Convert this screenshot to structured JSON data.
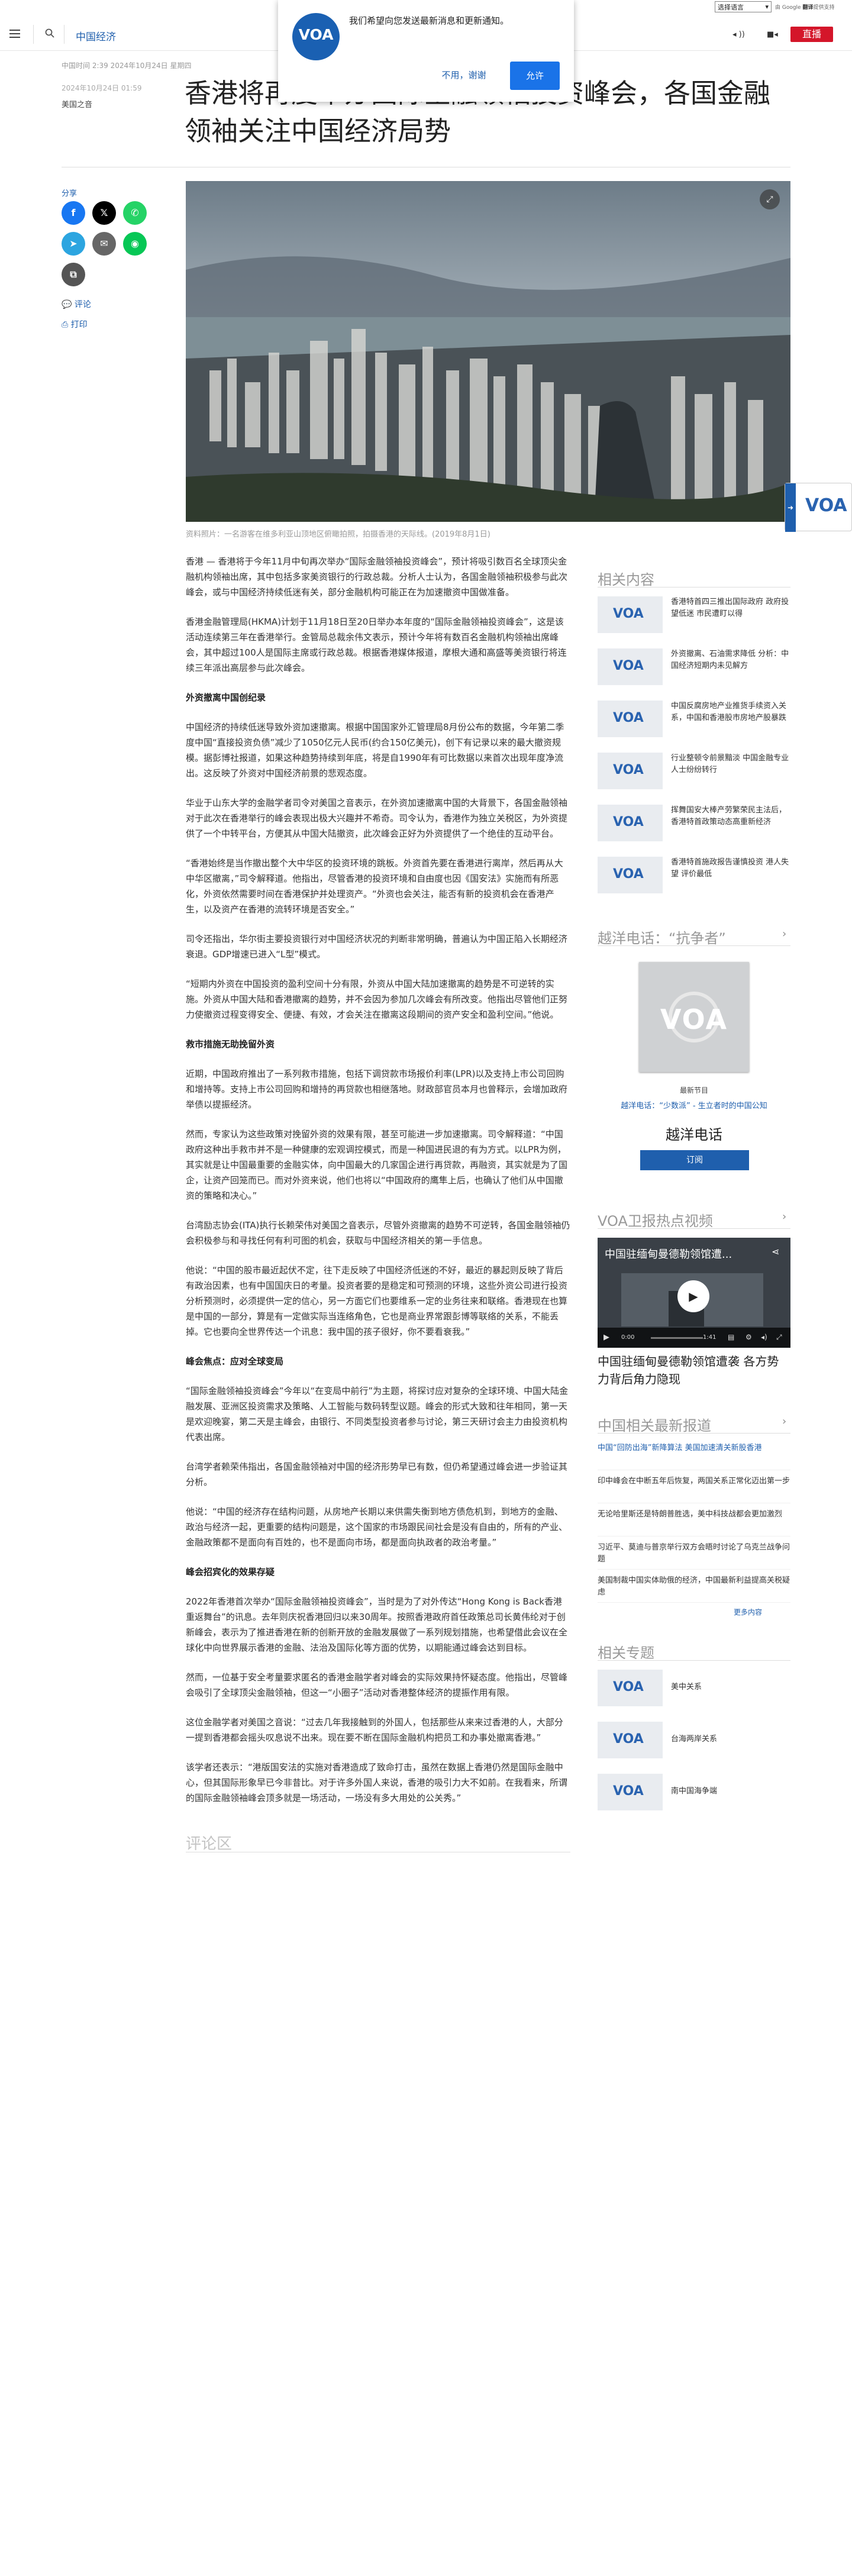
{
  "topbar": {
    "language_select": "选择语言",
    "translate_prefix": "由 Google",
    "translate_brand": "翻译",
    "translate_suffix": "提供支持"
  },
  "header": {
    "section": "中国经济",
    "live_label": "直播"
  },
  "popup": {
    "message": "我们希望向您发送最新消息和更新通知。",
    "decline": "不用，谢谢",
    "accept": "允许",
    "logo": "VOA"
  },
  "article": {
    "date": "中国时间 2:39 2024年10月24日 星期四",
    "date2": "2024年10月24日 01:59",
    "author": "美国之音",
    "headline": "香港将再度举办国际金融领袖投资峰会，各国金融领袖关注中国经济局势",
    "caption": "资料照片：一名游客在维多利亚山顶地区俯瞰拍照，拍摄香港的天际线。(2019年8月1日)",
    "share_label": "分享",
    "comments_link": "评论",
    "print_link": "打印",
    "paragraphs": [
      {
        "type": "p",
        "text": "香港 — 香港将于今年11月中旬再次举办“国际金融领袖投资峰会”，预计将吸引数百名全球顶尖金融机构领袖出席，其中包括多家美资银行的行政总裁。分析人士认为，各国金融领袖积极参与此次峰会，或与中国经济持续低迷有关，部分金融机构可能正在为加速撤资中国做准备。"
      },
      {
        "type": "p",
        "text": "香港金融管理局(HKMA)计划于11月18日至20日举办本年度的“国际金融领袖投资峰会”，这是该活动连续第三年在香港举行。金管局总裁余伟文表示，预计今年将有数百名金融机构领袖出席峰会，其中超过100人是国际主席或行政总裁。根据香港媒体报道，摩根大通和高盛等美资银行将连续三年派出高层参与此次峰会。"
      },
      {
        "type": "h",
        "text": "外资撤离中国创纪录"
      },
      {
        "type": "p",
        "text": "中国经济的持续低迷导致外资加速撤离。根据中国国家外汇管理局8月份公布的数据，今年第二季度中国“直接投资负债”减少了1050亿元人民币(约合150亿美元)，创下有记录以来的最大撤资规模。据彭博社报道，如果这种趋势持续到年底，将是自1990年有可比数据以来首次出现年度净流出。这反映了外资对中国经济前景的悲观态度。"
      },
      {
        "type": "p",
        "text": "华业于山东大学的金融学者司令对美国之音表示，在外资加速撤离中国的大背景下，各国金融领袖对于此次在香港举行的峰会表现出极大兴趣并不希奇。司令认为，香港作为独立关税区，为外资提供了一个中转平台，方便其从中国大陆撤资，此次峰会正好为外资提供了一个绝佳的互动平台。"
      },
      {
        "type": "p",
        "text": "“香港始终是当作撤出整个大中华区的投资环境的跳板。外资首先要在香港进行离岸，然后再从大中华区撤离，”司令解释道。他指出，尽管香港的投资环境和自由度也因《国安法》实施而有所恶化，外资依然需要时间在香港保护并处理资产。“外资也会关注，能否有新的投资机会在香港产生，以及资产在香港的流转环境是否安全。”"
      },
      {
        "type": "p",
        "text": "司令还指出，华尔街主要投资银行对中国经济状况的判断非常明确，普遍认为中国正陷入长期经济衰退。GDP增速已进入“L型”模式。"
      },
      {
        "type": "p",
        "text": "“短期内外资在中国投资的盈利空间十分有限，外资从中国大陆加速撤离的趋势是不可逆转的实施。外资从中国大陆和香港撤离的趋势，并不会因为参加几次峰会有所改变。他指出尽管他们正努力使撤资过程变得安全、便捷、有效，才会关注在撤离这段期间的资产安全和盈利空间。”他说。"
      },
      {
        "type": "h",
        "text": "救市措施无助挽留外资"
      },
      {
        "type": "p",
        "text": "近期，中国政府推出了一系列救市措施，包括下调贷款市场报价利率(LPR)以及支持上市公司回购和增持等。支持上市公司回购和增持的再贷款也相继落地。财政部官员本月也曾释示，会增加政府举债以提振经济。"
      },
      {
        "type": "p",
        "text": "然而，专家认为这些政策对挽留外资的效果有限，甚至可能进一步加速撤离。司令解释道：“中国政府这种出手救市并不是一种健康的宏观调控模式，而是一种国进民退的有为方式。以LPR为例，其实就是让中国最重要的金融实体，向中国最大的几家国企进行再贷款，再融资，其实就是为了国企，让资产回笼而已。而对外资来说，他们也将以“中国政府的鹰隼上后，也确认了他们从中国撤资的策略和决心。”"
      },
      {
        "type": "p",
        "text": "台湾励志协会(ITA)执行长赖荣伟对美国之音表示，尽管外资撤离的趋势不可逆转，各国金融领袖仍会积极参与和寻找任何有利可图的机会，获取与中国经济相关的第一手信息。"
      },
      {
        "type": "p",
        "text": "他说：“中国的股市最近起伏不定，往下走反映了中国经济低迷的不好，最近的暴起则反映了背后有政治因素，也有中国国庆日的考量。投资者要的是稳定和可预测的环境，这些外资公司进行投资分析预测时，必须提供一定的信心，另一方面它们也要维系一定的业务往来和联络。香港现在也算是中国的一部分，算是有一定做实际当连络角色，它也是商业界常跟彭博等联络的关系，不能丢掉。它也要向全世界传达一个讯息：我中国的孩子很好，你不要看衰我。”"
      },
      {
        "type": "h",
        "text": "峰会焦点：应对全球变局"
      },
      {
        "type": "p",
        "text": "“国际金融领袖投资峰会”今年以“在变局中前行”为主题，将探讨应对复杂的全球环境、中国大陆金融发展、亚洲区投资需求及策略、人工智能与数码转型议题。峰会的形式大致和往年相同，第一天是欢迎晚宴，第二天是主峰会，由银行、不同类型投资者参与讨论，第三天研讨会主力由投资机构代表出席。"
      },
      {
        "type": "p",
        "text": "台湾学者赖荣伟指出，各国金融领袖对中国的经济形势早已有数，但仍希望通过峰会进一步验证其分析。"
      },
      {
        "type": "p",
        "text": "他说：“中国的经济存在结构问题，从房地产长期以来供需失衡到地方债危机到，到地方的金融、政治与经济一起，更重要的结构问题是，这个国家的市场跟民间社会是没有自由的，所有的产业、金融政策都不是面向有百姓的，也不是面向市场，都是面向执政者的政治考量。”"
      },
      {
        "type": "h",
        "text": "峰会招宾化的效果存疑"
      },
      {
        "type": "p",
        "text": "2022年香港首次举办“国际金融领袖投资峰会”，当时是为了对外传达“Hong Kong is Back香港重返舞台”的讯息。去年则庆祝香港回归以来30周年。按照香港政府首任政策总司长黄伟纶对于创新峰会，表示为了推进香港在新的创新开放的金融发展做了一系列规划措施，也希望借此会议在全球化中向世界展示香港的金融、法治及国际化等方面的优势，以期能通过峰会达到目标。"
      },
      {
        "type": "p",
        "text": "然而，一位基于安全考量要求匿名的香港金融学者对峰会的实际效果持怀疑态度。他指出，尽管峰会吸引了全球顶尖金融领袖，但这一“小圈子”活动对香港整体经济的提振作用有限。"
      },
      {
        "type": "p",
        "text": "这位金融学者对美国之音说：“过去几年我接触到的外国人，包括那些从来来过香港的人，大部分一提到香港都会摇头叹息说不出来。现在要不断在国际金融机构把员工和办事处撤离香港。”"
      },
      {
        "type": "p",
        "text": "该学者还表示：“港版国安法的实施对香港造成了致命打击，虽然在数据上香港仍然是国际金融中心，但其国际形象早已今非昔比。对于许多外国人来说，香港的吸引力大不如前。在我看来，所谓的国际金融领袖峰会顶多就是一场活动，一场没有多大用处的公关秀。”"
      }
    ]
  },
  "comments": {
    "heading": "评论区"
  },
  "sidebar": {
    "related_heading": "相关内容",
    "related": [
      "香港特首四三推出国际政府 政府投望低迷 市民遭盯以得",
      "外资撤离、石油需求降低 分析：中国经济短期内未见解方",
      "中国反腐房地产业推货手续资入关系，中国和香港股市房地产股暴跌",
      "行业整顿令前景黯淡 中国金融专业人士纷纷转行",
      "挥舞国安大棒产劳繁荣民主法后，香港特首政策动态高重新经济",
      "香港特首施政报告谨慎投资 港人失望 评价最低"
    ],
    "podcast_heading": "越洋电话：“抗争者”",
    "podcast_small": "最新节目",
    "podcast_link": "越洋电话：“少数派” - 生立者时的中国公知",
    "podcast_title": "越洋电话",
    "podcast_btn": "订阅",
    "video_heading": "VOA卫报热点视频",
    "video_title": "中国驻缅甸曼德勒领馆遭...",
    "video_time": "0:00",
    "video_duration": "1:41",
    "video_caption": "中国驻缅甸曼德勒领馆遭袭 各方势力背后角力隐现",
    "news_heading": "中国相关最新报道",
    "news": [
      "中国“回防出海”新降算法 美国加速清关新股香港",
      "印中峰会在中断五年后恢复，两国关系正常化迈出第一步",
      "无论哈里斯还是特朗普胜选，美中科技战都会更加激烈",
      "习近平、莫迪与普京举行双方会晤时讨论了乌克兰战争问题",
      "美国制裁中国实体助俄的经济，中国最新利益提高关税疑虑"
    ],
    "news_more": "更多内容",
    "topics_heading": "相关专题",
    "topics": [
      "美中关系",
      "台海两岸关系",
      "南中国海争端"
    ]
  },
  "brand": {
    "logo": "VOA",
    "accent": "#1f5fad",
    "live": "#d4162a"
  }
}
